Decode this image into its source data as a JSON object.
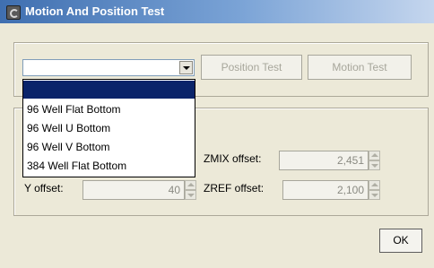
{
  "window": {
    "title": "Motion And Position Test"
  },
  "toolbar": {
    "plate_select_value": "",
    "position_test_label": "Position Test",
    "motion_test_label": "Motion Test"
  },
  "dropdown": {
    "options": [
      "",
      "96 Well Flat Bottom",
      "96 Well U Bottom",
      "96 Well V Bottom",
      "384 Well Flat Bottom"
    ],
    "highlighted_index": 0
  },
  "offsets": {
    "y_offset_label": "Y offset:",
    "y_offset_value": "40",
    "zmix_offset_label": "ZMIX offset:",
    "zmix_offset_value": "2,451",
    "zref_offset_label": "ZREF offset:",
    "zref_offset_value": "2,100"
  },
  "footer": {
    "ok_label": "OK"
  },
  "colors": {
    "title_gradient_start": "#3f6fb0",
    "title_gradient_end": "#c5d6ee",
    "dialog_bg": "#ece9d8",
    "selection": "#0a246a"
  }
}
